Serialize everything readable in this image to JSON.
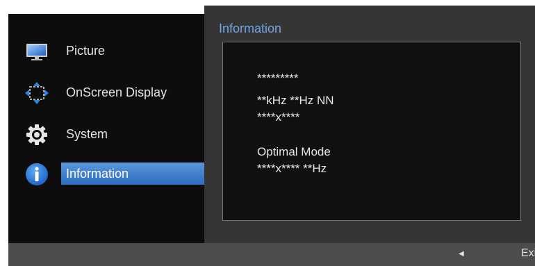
{
  "menu": {
    "items": [
      {
        "label": "Picture",
        "icon": "monitor-icon"
      },
      {
        "label": "OnScreen Display",
        "icon": "move-arrows-icon"
      },
      {
        "label": "System",
        "icon": "gear-icon"
      },
      {
        "label": "Information",
        "icon": "info-icon",
        "selected": true
      }
    ]
  },
  "panel": {
    "title": "Information",
    "lines": [
      "*********",
      "**kHz **Hz NN",
      "****x****",
      "Optimal Mode",
      "****x**** **Hz"
    ]
  },
  "bottom_bar": {
    "arrow_icon": "left-arrow-icon",
    "exit_label": "Exit"
  },
  "colors": {
    "accent": "#2d6cc0",
    "title": "#6fa7e6",
    "panel": "#353535",
    "menu_bg": "#0d0d0d"
  }
}
